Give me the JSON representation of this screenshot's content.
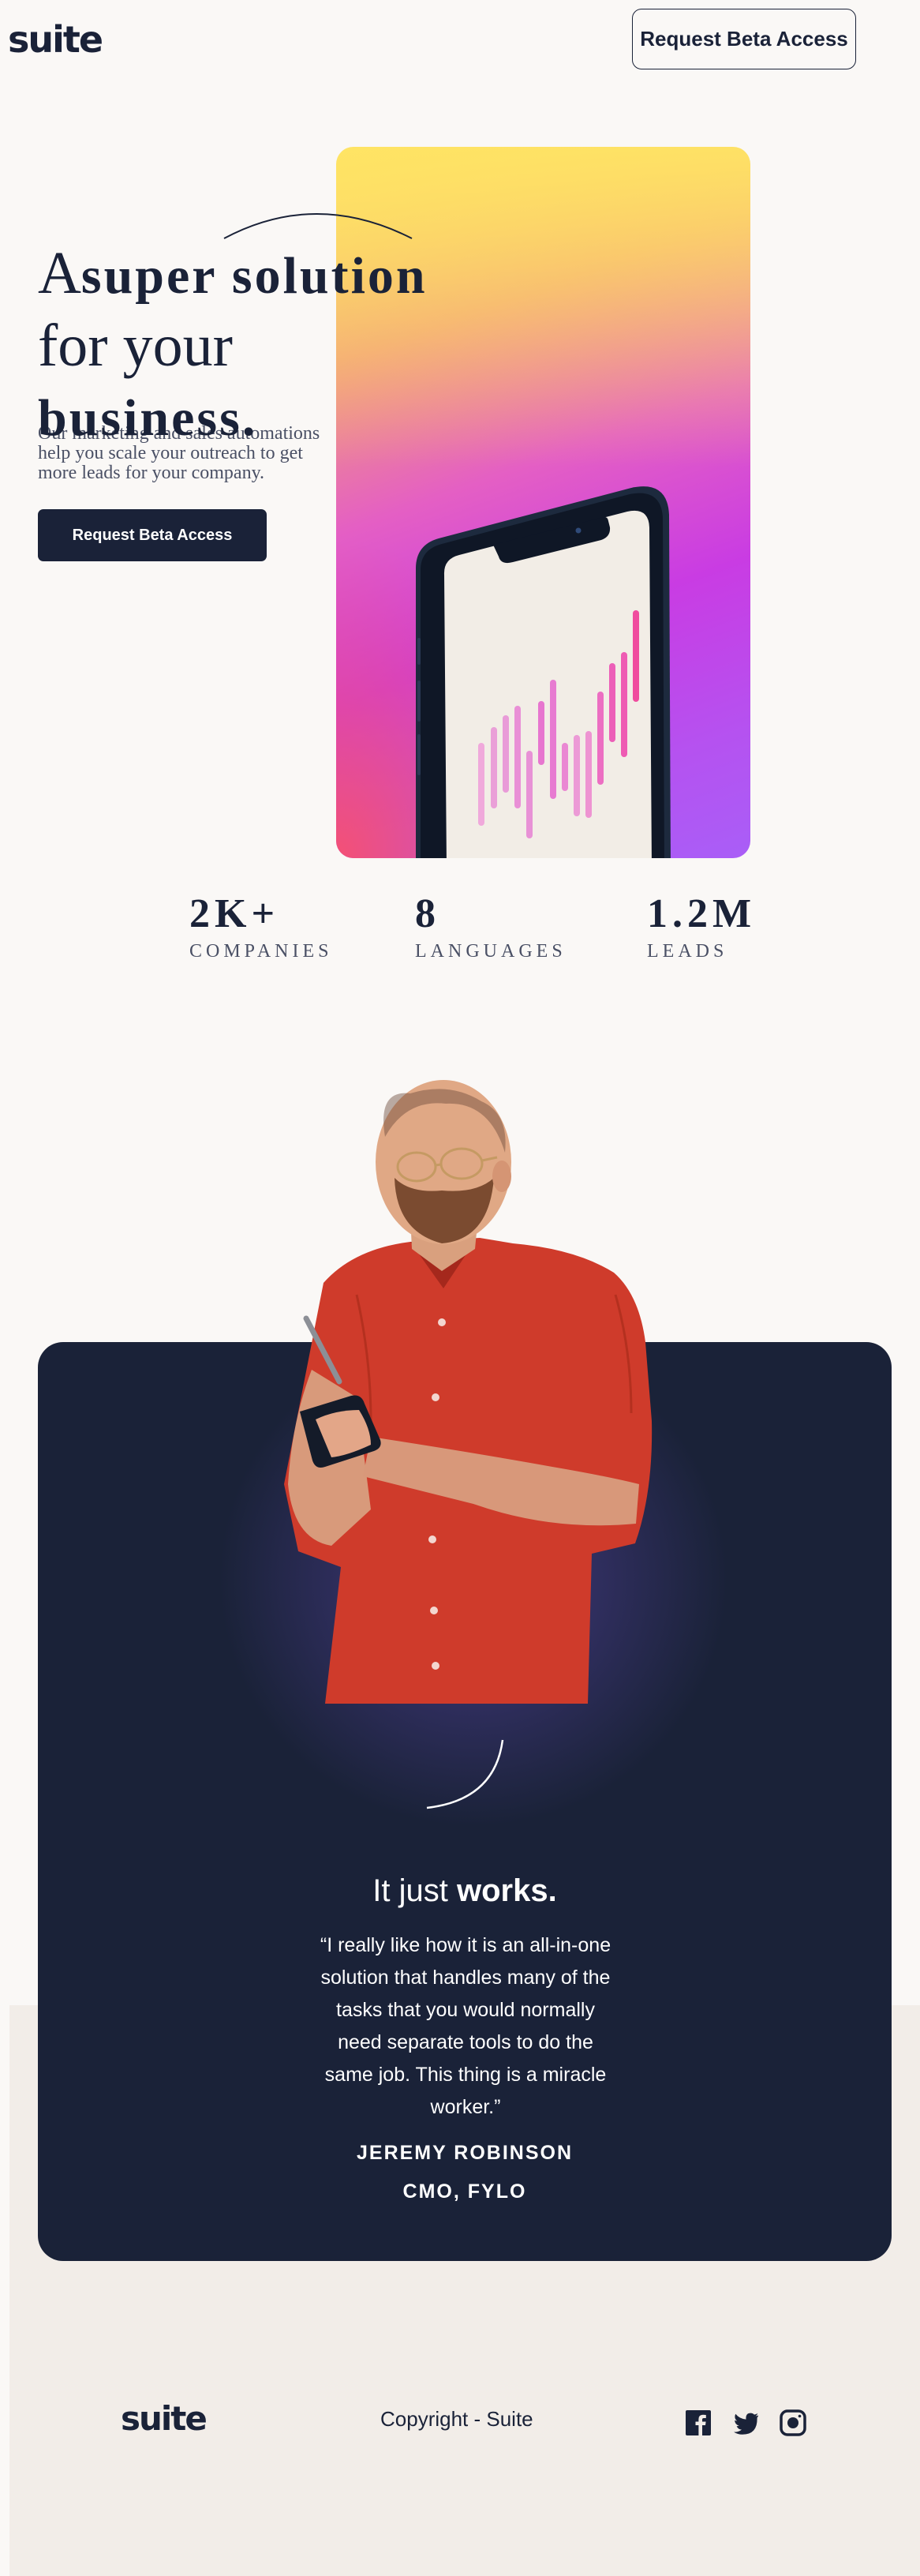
{
  "header": {
    "logo": "suite",
    "cta_label": "Request Beta Access"
  },
  "hero": {
    "headline": {
      "line1_regular": "A",
      "line1_bold": "super solution",
      "line2_regular": "for your",
      "line2_bold": "business."
    },
    "subtext": "Our marketing and sales automations help you scale your outreach to get more leads for your company.",
    "cta_label": "Request Beta Access"
  },
  "stats": [
    {
      "value": "2K+",
      "label": "COMPANIES"
    },
    {
      "value": "8",
      "label": "LANGUAGES"
    },
    {
      "value": "1.2M",
      "label": "LEADS"
    }
  ],
  "testimonial": {
    "heading_regular": "It just",
    "heading_bold": "works.",
    "quote": "“I really like how it is an all-in-one solution that handles many of the tasks that you would normally need separate tools to do the same job. This thing is a miracle worker.”",
    "name": "JEREMY ROBINSON",
    "role": "CMO, FYLO"
  },
  "footer": {
    "logo": "suite",
    "copyright": "Copyright - Suite",
    "social": [
      "facebook-icon",
      "twitter-icon",
      "instagram-icon"
    ]
  },
  "colors": {
    "navy": "#1a2238",
    "background": "#faf8f6",
    "band": "#f2ede8",
    "text_muted": "#4a5065"
  }
}
